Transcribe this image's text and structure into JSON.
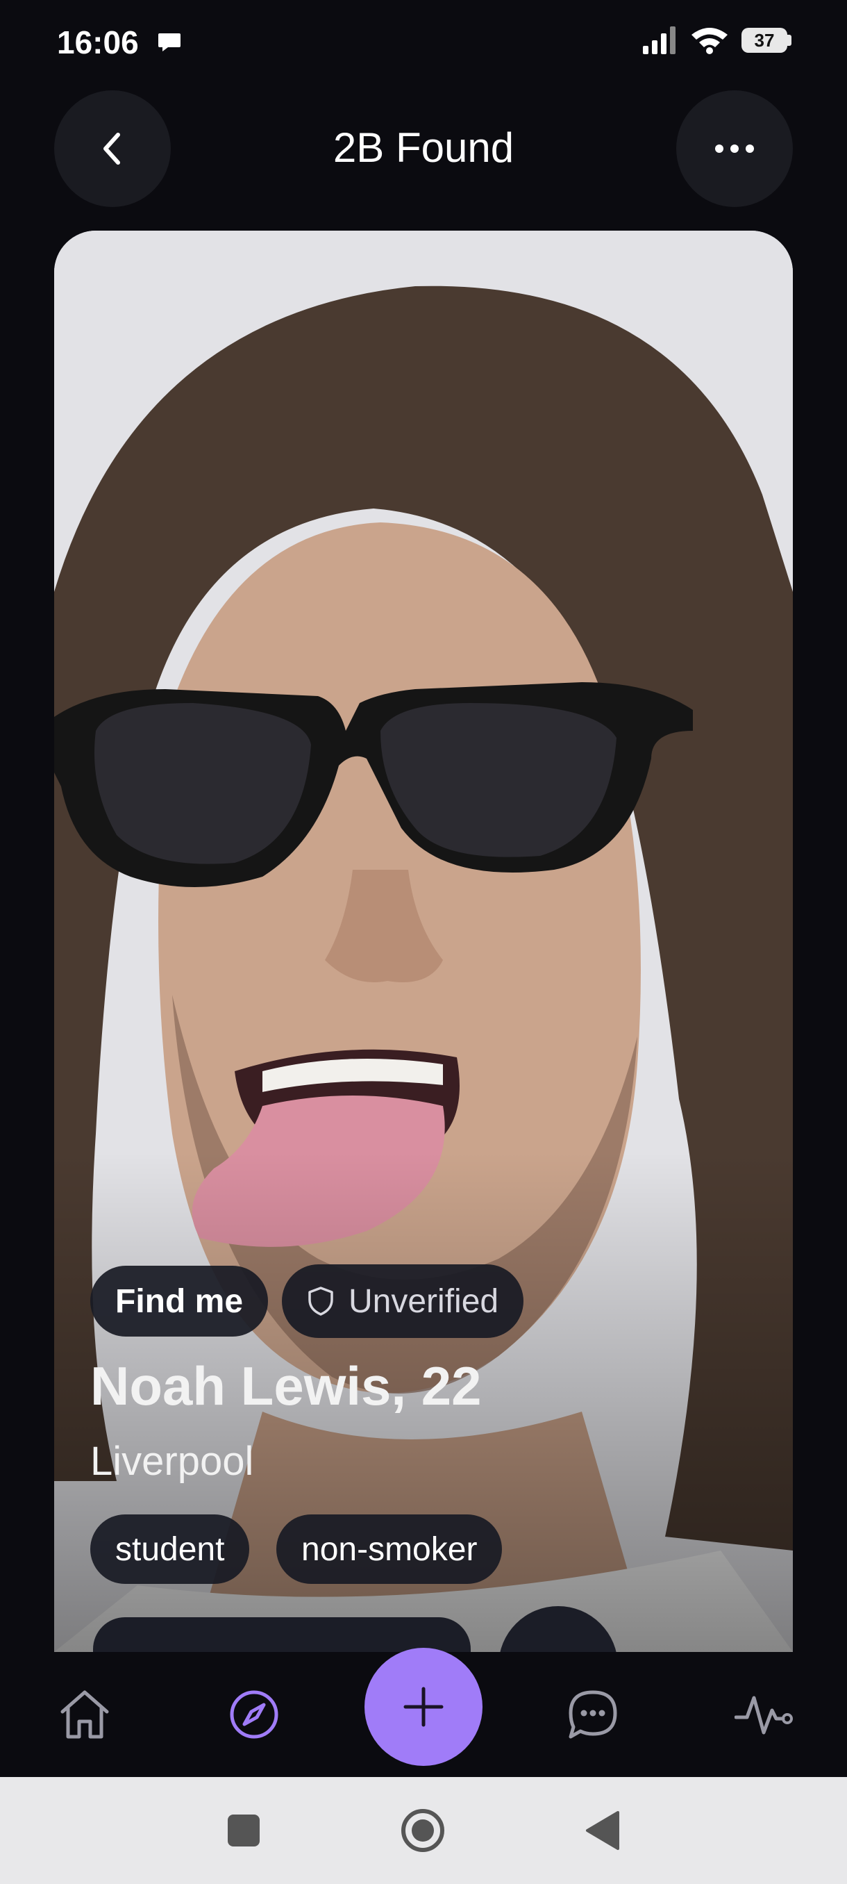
{
  "status_bar": {
    "time": "16:06",
    "battery_level": "37"
  },
  "header": {
    "title": "2B Found",
    "back_icon": "chevron-left-icon",
    "more_icon": "more-horizontal-icon"
  },
  "profile": {
    "find_me_label": "Find me",
    "verification_label": "Unverified",
    "name_age": "Noah Lewis, 22",
    "city": "Liverpool",
    "tags": [
      "student",
      "non-smoker"
    ]
  },
  "bottom_nav": {
    "items": [
      {
        "name": "home",
        "icon": "home-icon"
      },
      {
        "name": "explore",
        "icon": "compass-icon",
        "active": true
      },
      {
        "name": "add",
        "icon": "plus-icon"
      },
      {
        "name": "chats",
        "icon": "chat-icon"
      },
      {
        "name": "activity",
        "icon": "activity-icon"
      }
    ]
  },
  "colors": {
    "background": "#0b0b10",
    "accent": "#a07cf8",
    "chip": "#181a24"
  }
}
